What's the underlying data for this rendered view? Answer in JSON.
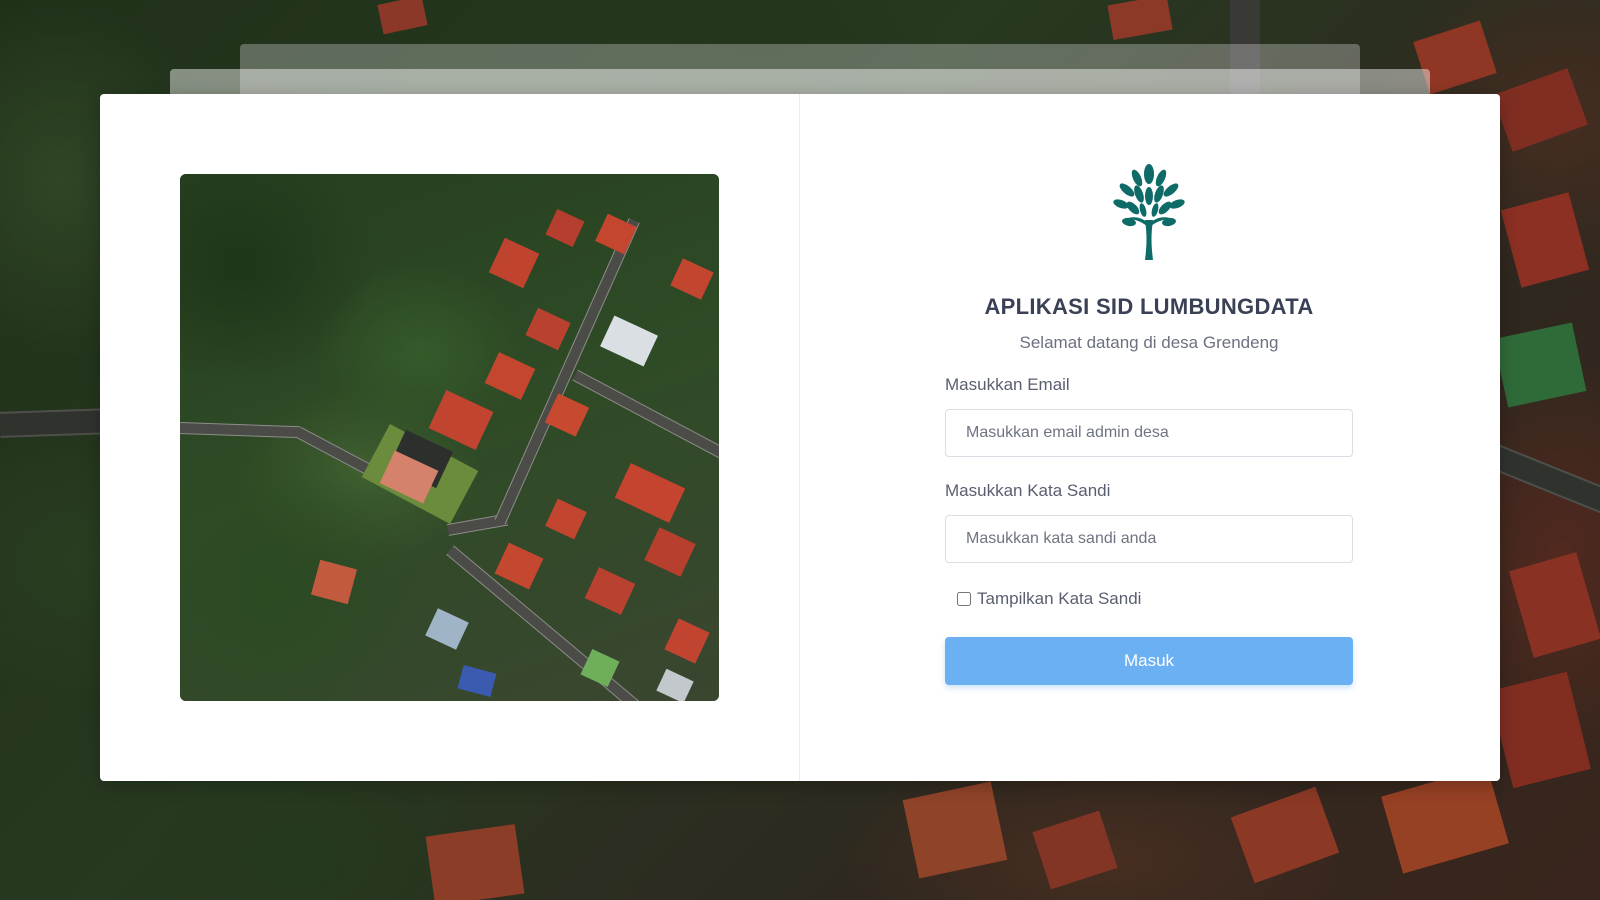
{
  "app": {
    "title": "APLIKASI SID LUMBUNGDATA",
    "subtitle": "Selamat datang di desa Grendeng",
    "logo_icon": "tree-logo-icon",
    "brand_color": "#0e6b68"
  },
  "login_form": {
    "email_label": "Masukkan Email",
    "email_placeholder": "Masukkan email admin desa",
    "password_label": "Masukkan Kata Sandi",
    "password_placeholder": "Masukkan kata sandi anda",
    "show_password_label": "Tampilkan Kata Sandi",
    "show_password_checked": false,
    "submit_label": "Masuk",
    "submit_color": "#6bb0f3"
  },
  "hero_image": {
    "subject": "aerial-village-photo"
  }
}
